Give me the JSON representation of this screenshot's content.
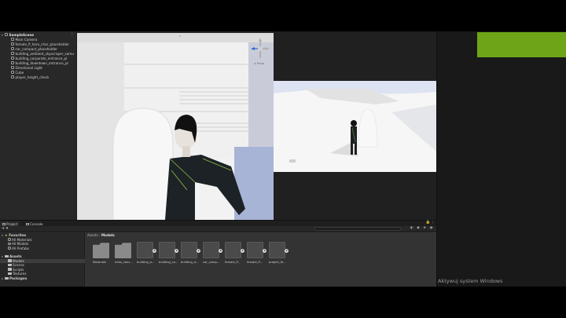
{
  "hierarchy": {
    "scene_name": "SampleScene",
    "items": [
      "Main Camera",
      "female_P_hero_char_placeholder",
      "car_compact_placeholder",
      "building_ambient_skyscraper_samu",
      "building_corporate_entrance_pl",
      "building_downtown_entrance_pl",
      "Directional Light",
      "Cube",
      "player_height_check"
    ]
  },
  "scene_view": {
    "gizmo_label": "≤ Persp"
  },
  "project": {
    "tabs": [
      "Project",
      "Console"
    ],
    "add_label": "+ ▾",
    "favorites_label": "Favorites",
    "favorites": [
      "All Materials",
      "All Models",
      "All Prefabs"
    ],
    "assets_label": "Assets",
    "asset_folders": [
      "Models",
      "Scenes",
      "Scripts",
      "Textures"
    ],
    "packages_label": "Packages",
    "breadcrumb_root": "Assets",
    "breadcrumb_sep": " › ",
    "breadcrumb_current": "Models",
    "assets": [
      {
        "label": "Materials",
        "kind": "folder"
      },
      {
        "label": "Infos_cons...",
        "kind": "folder"
      },
      {
        "label": "building_a...",
        "kind": "model"
      },
      {
        "label": "building_co...",
        "kind": "model"
      },
      {
        "label": "building_d...",
        "kind": "model"
      },
      {
        "label": "car_comp...",
        "kind": "model"
      },
      {
        "label": "female_P...",
        "kind": "model"
      },
      {
        "label": "female_P...",
        "kind": "model"
      },
      {
        "label": "project_fe...",
        "kind": "model"
      }
    ]
  },
  "os_watermark": "Aktywuj system Windows",
  "colors": {
    "accent_green": "#6ea518",
    "editor_bg": "#282828",
    "folder_yellow": "#c9a94a"
  }
}
